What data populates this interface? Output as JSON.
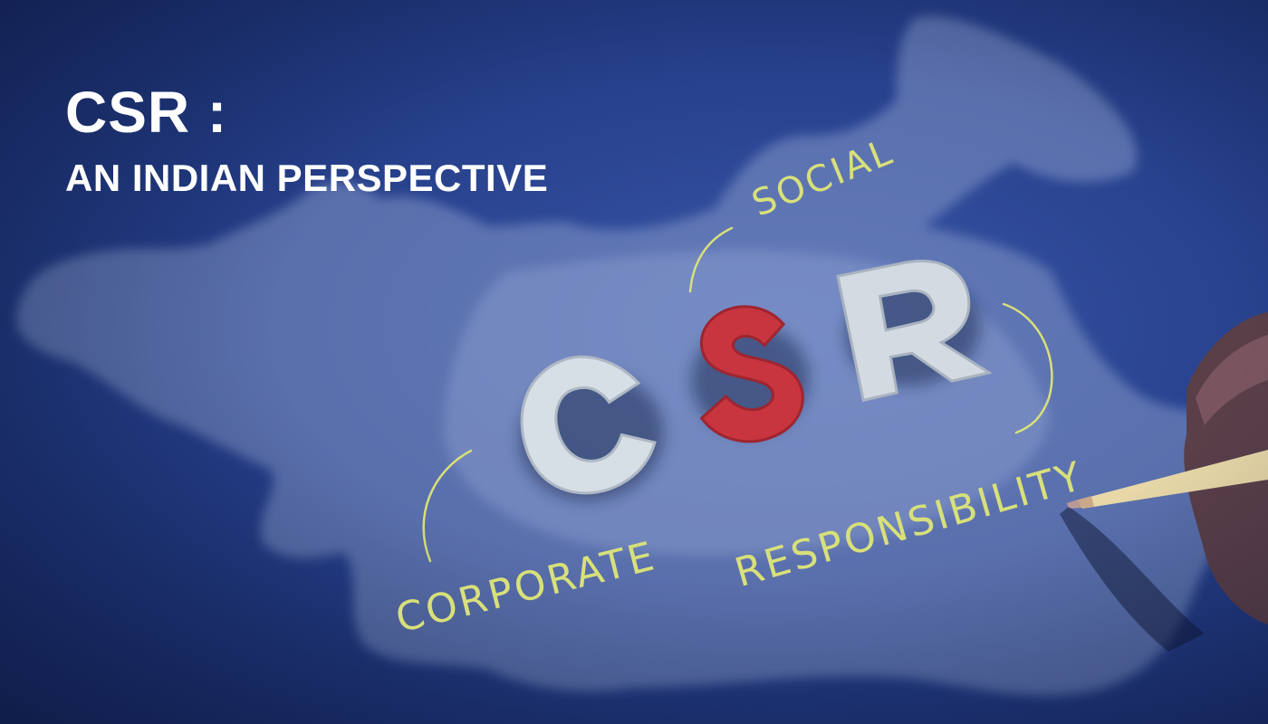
{
  "headline": {
    "title": "CSR :",
    "subtitle": "AN INDIAN PERSPECTIVE"
  },
  "board": {
    "letters": [
      "C",
      "S",
      "R"
    ],
    "letter_colors": {
      "C": "#d6dee6",
      "S": "#c8353f",
      "R": "#d3dae2"
    }
  },
  "handwriting": {
    "social": "SOCIAL",
    "corporate": "CORPORATE",
    "responsibility": "RESPONSIBILITY"
  },
  "colors": {
    "background": "#213a82",
    "map_fill": "#8497c9",
    "handwriting": "#d8e07a",
    "headline": "#ffffff"
  }
}
